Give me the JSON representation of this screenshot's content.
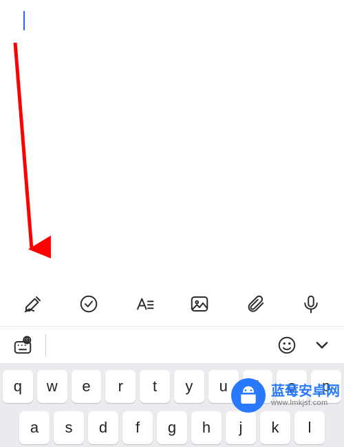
{
  "editor": {
    "text": ""
  },
  "annotation": {
    "arrow_color": "#ff0000"
  },
  "toolbar": {
    "icons": [
      "handwriting-icon",
      "checkmark-circle-icon",
      "text-format-icon",
      "image-icon",
      "attachment-icon",
      "microphone-icon"
    ]
  },
  "keyboard_header": {
    "icons": [
      "globe-keyboard-icon",
      "emoji-icon",
      "collapse-keyboard-icon"
    ]
  },
  "keyboard": {
    "row1": [
      "q",
      "w",
      "e",
      "r",
      "t",
      "y",
      "u",
      "i",
      "o",
      "p"
    ],
    "row2": [
      "a",
      "s",
      "d",
      "f",
      "g",
      "h",
      "j",
      "k",
      "l"
    ]
  },
  "watermark": {
    "title": "蓝莓安卓网",
    "url": "www.lmkjst.com"
  },
  "colors": {
    "cursor": "#2962ff",
    "keyboard_bg": "#e9ebee",
    "key_bg": "#ffffff",
    "icon": "#2c2c2c",
    "brand": "#2979ff"
  }
}
